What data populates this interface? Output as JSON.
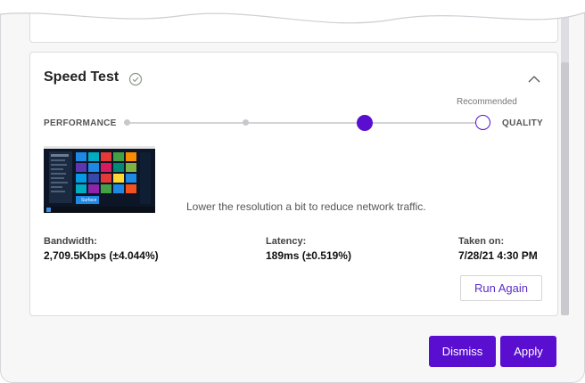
{
  "speed_test": {
    "title": "Speed Test",
    "recommended_label": "Recommended",
    "slider": {
      "left_label": "PERFORMANCE",
      "right_label": "QUALITY",
      "stops": 4,
      "selected_index": 2,
      "recommended_index": 3
    },
    "hint": "Lower the resolution a bit to reduce network traffic.",
    "preview_text": "Surface",
    "stats": {
      "bandwidth_label": "Bandwidth:",
      "bandwidth_value": "2,709.5Kbps (±4.044%)",
      "latency_label": "Latency:",
      "latency_value": "189ms (±0.519%)",
      "taken_label": "Taken on:",
      "taken_value": "7/28/21 4:30 PM"
    },
    "run_again_label": "Run Again"
  },
  "footer": {
    "dismiss_label": "Dismiss",
    "apply_label": "Apply"
  },
  "colors": {
    "accent": "#5a0fd0",
    "link": "#5a2dc8",
    "check": "#8a9a8a"
  },
  "icons": {
    "status": "check-circle-icon",
    "collapse": "chevron-up-icon"
  }
}
